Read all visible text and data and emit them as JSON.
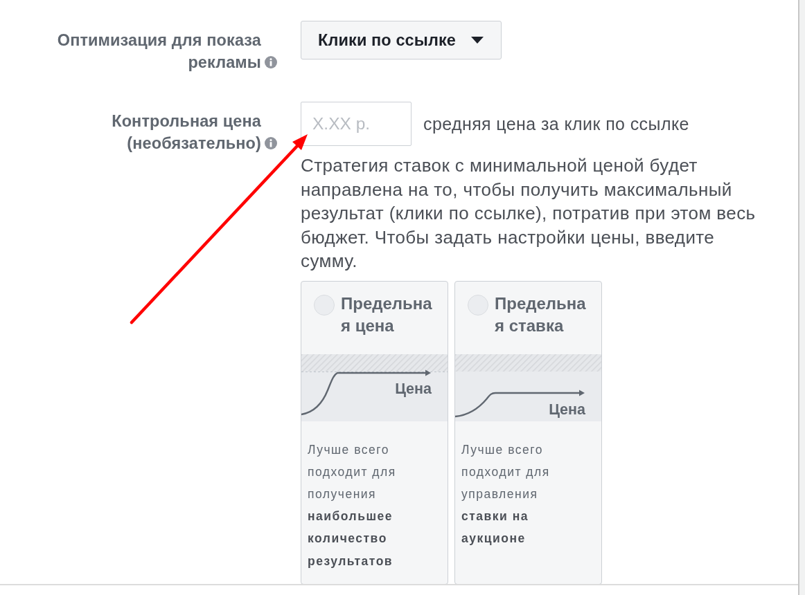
{
  "settings": [
    {
      "kind": "dropdown",
      "label": "Оптимизация для показа рекламы",
      "info": true,
      "value": "Клики по ссылке"
    },
    {
      "kind": "amount",
      "label": "Контрольная цена (необязательно)",
      "info": true,
      "placeholder": "X.XX р.",
      "suffix": "средняя цена за клик по ссылке",
      "help": "Стратегия ставок с минимальной ценой будет направлена на то, чтобы получить максимальный результат (клики по ссылке), потратив при этом весь бюджет. Чтобы задать настройки цены, введите сумму.",
      "options": [
        {
          "kind": "cost_cap",
          "title": "Предельная цена",
          "selected": false,
          "axis_label": "Цена",
          "description": "Лучше всего подходит для получения **наибольшее количество результатов**"
        },
        {
          "kind": "bid_cap",
          "title": "Предельная ставка",
          "selected": false,
          "axis_label": "Цена",
          "description": "Лучше всего подходит для управления **ставки на аукционе**"
        }
      ]
    }
  ],
  "annotations": [
    {
      "kind": "arrow"
    }
  ]
}
